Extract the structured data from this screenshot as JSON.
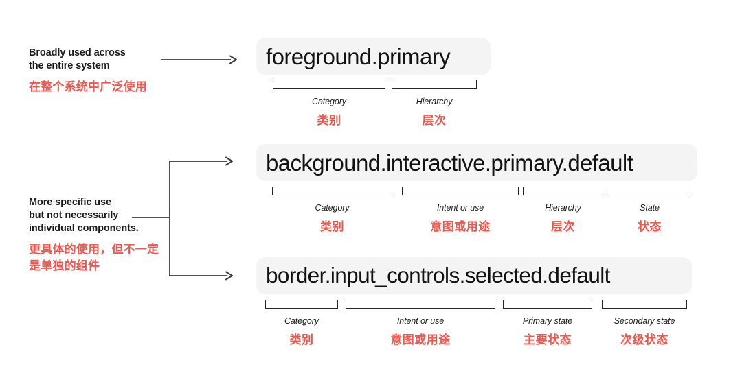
{
  "notes": [
    {
      "en": "Broadly used across\nthe entire system",
      "zh": "在整个系统中广泛使用"
    },
    {
      "en": "More specific use\nbut not necessarily\nindividual components.",
      "zh": "更具体的使用，但不一定\n是单独的组件"
    }
  ],
  "rows": [
    {
      "token": "foreground.primary",
      "segments": [
        {
          "en": "Category",
          "zh": "类别"
        },
        {
          "en": "Hierarchy",
          "zh": "层次"
        }
      ]
    },
    {
      "token": "background.interactive.primary.default",
      "segments": [
        {
          "en": "Category",
          "zh": "类别"
        },
        {
          "en": "Intent or use",
          "zh": "意图或用途"
        },
        {
          "en": "Hierarchy",
          "zh": "层次"
        },
        {
          "en": "State",
          "zh": "状态"
        }
      ]
    },
    {
      "token": "border.input_controls.selected.default",
      "segments": [
        {
          "en": "Category",
          "zh": "类别"
        },
        {
          "en": "Intent or use",
          "zh": "意图或用途"
        },
        {
          "en": "Primary state",
          "zh": "主要状态"
        },
        {
          "en": "Secondary state",
          "zh": "次级状态"
        }
      ]
    }
  ],
  "colors": {
    "accent_red": "#F1564D",
    "pill_background": "#f4f4f4",
    "text_primary": "#121212",
    "connector": "#3a3a3a"
  }
}
